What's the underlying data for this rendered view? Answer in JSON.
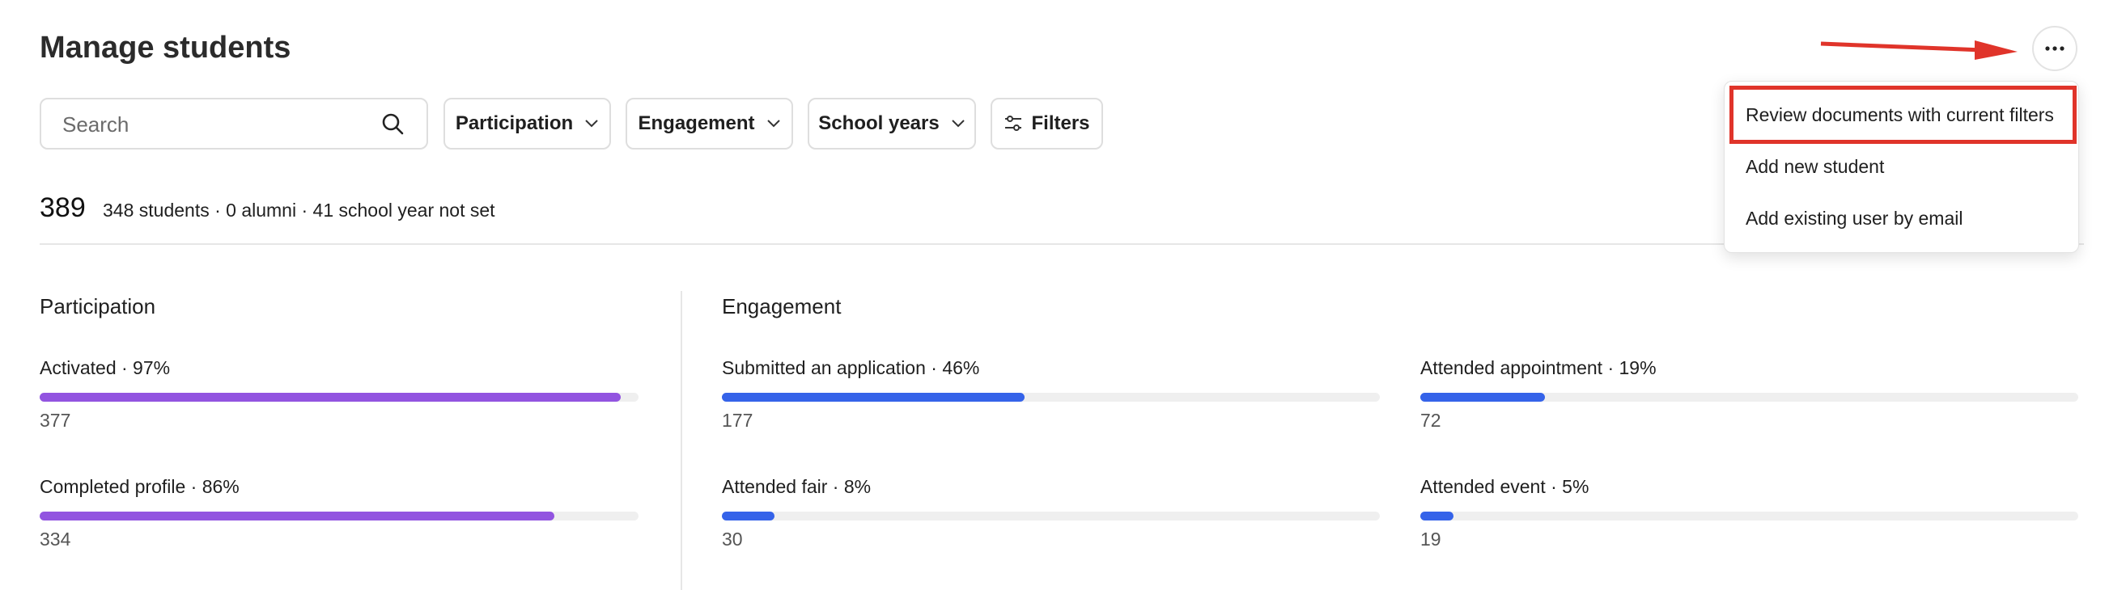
{
  "header": {
    "title": "Manage students"
  },
  "search": {
    "placeholder": "Search",
    "value": ""
  },
  "filters": [
    {
      "label": "Participation"
    },
    {
      "label": "Engagement"
    },
    {
      "label": "School years"
    },
    {
      "label": "Filters"
    }
  ],
  "summary": {
    "total": "389",
    "breakdown": "348 students · 0 alumni · 41 school year not set"
  },
  "participation": {
    "title": "Participation",
    "stats": [
      {
        "label": "Activated · 97%",
        "percent": 97,
        "count": "377"
      },
      {
        "label": "Completed profile · 86%",
        "percent": 86,
        "count": "334"
      }
    ]
  },
  "engagement": {
    "title": "Engagement",
    "stats": [
      {
        "label": "Submitted an application · 46%",
        "percent": 46,
        "count": "177"
      },
      {
        "label": "Attended appointment · 19%",
        "percent": 19,
        "count": "72"
      },
      {
        "label": "Attended fair · 8%",
        "percent": 8,
        "count": "30"
      },
      {
        "label": "Attended event · 5%",
        "percent": 5,
        "count": "19"
      }
    ]
  },
  "menu": {
    "items": [
      {
        "label": "Review documents with current filters"
      },
      {
        "label": "Add new student"
      },
      {
        "label": "Add existing user by email"
      }
    ]
  },
  "colors": {
    "participation_bar": "#9254e0",
    "engagement_bar": "#3563e9",
    "track": "#efefef",
    "annotation": "#e0342a"
  }
}
